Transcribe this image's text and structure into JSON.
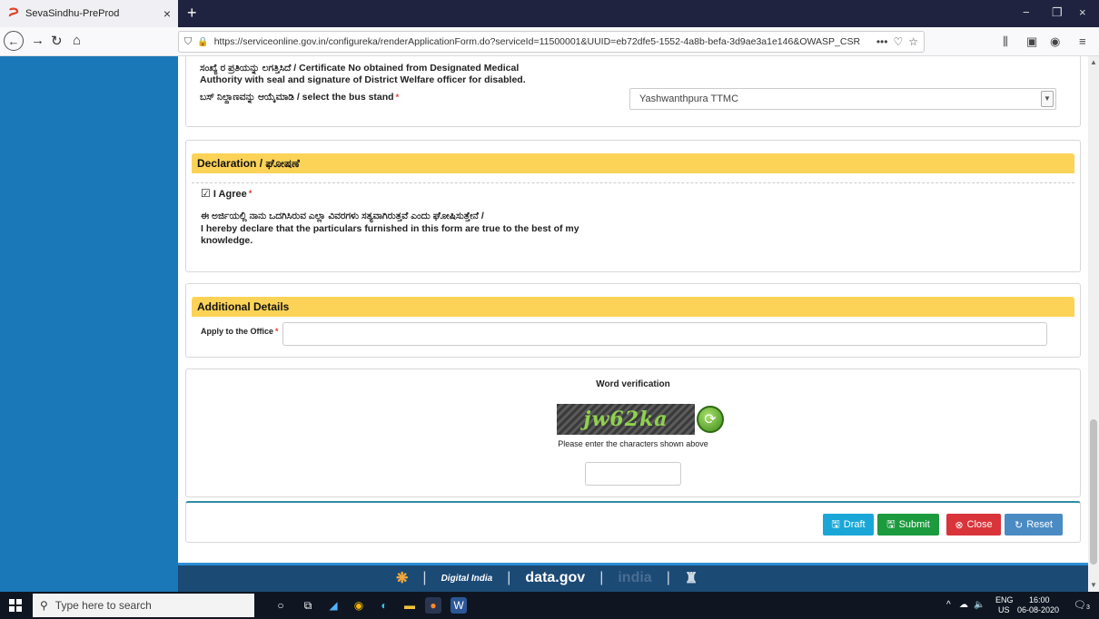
{
  "browser": {
    "tab_title": "SevaSindhu-PreProd",
    "tab_close": "×",
    "new_tab": "+",
    "min": "−",
    "restore": "❐",
    "close": "×",
    "url": "https://serviceonline.gov.in/configureka/renderApplicationForm.do?serviceId=11500001&UUID=eb72dfe5-1552-4a8b-befa-3d9ae3a1e146&OWASP_CSR",
    "more": "•••"
  },
  "form": {
    "certificate_label_line1": "ಸಂಖ್ಯೆ ರ ಪ್ರತಿಯನ್ನು ಲಗತ್ತಿಸಿದೆ / Certificate No obtained from Designated Medical",
    "certificate_label_line2": "Authority with seal and signature of District Welfare officer for disabled.",
    "bus_stand_label": "ಬಸ್ ನಿಲ್ದಾಣವನ್ನು ಆಯ್ಕೆಮಾಡಿ / select the bus stand",
    "bus_stand_value": "Yashwanthpura TTMC",
    "required_mark": "*",
    "declaration_header": "Declaration / ಘೋಷಣೆ",
    "agree_label": "I Agree",
    "agree_check": "☑",
    "declaration_kn": "ಈ ಅರ್ಜಿಯಲ್ಲಿ ನಾನು ಒದಗಿಸಿರುವ ಎಲ್ಲಾ ವಿವರಗಳು ಸತ್ಯವಾಗಿರುತ್ತವೆ ಎಂದು ಘೋಷಿಸುತ್ತೇನೆ /",
    "declaration_en1": "I hereby declare that the particulars furnished in this form are true to the best of my",
    "declaration_en2": "knowledge.",
    "additional_header": "Additional Details",
    "office_label": "Apply to the Office",
    "word_verification_title": "Word verification",
    "captcha_text": "jw62ka",
    "captcha_hint": "Please enter the characters shown above",
    "buttons": {
      "draft": "Draft",
      "submit": "Submit",
      "close": "Close",
      "reset": "Reset"
    }
  },
  "footer": {
    "digital_india": "Digital India",
    "data_gov": "data.gov",
    "india": "india",
    "sep": "|"
  },
  "taskbar": {
    "search_placeholder": "Type here to search",
    "lang": "ENG",
    "region": "US",
    "time": "16:00",
    "date": "06-08-2020",
    "notif_count": "3"
  },
  "colors": {
    "section_header": "#fcd357",
    "left_panel": "#1b78b8",
    "draft": "#1aa7d8",
    "submit": "#1c9a3e",
    "close": "#d9343a",
    "reset": "#4a8bc4"
  }
}
